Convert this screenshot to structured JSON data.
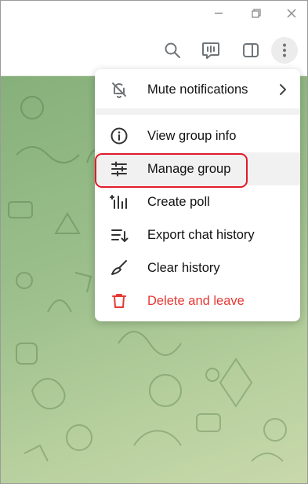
{
  "colors": {
    "accent_highlight": "#e21b2a",
    "danger": "#e53935",
    "chat_background": "#9dc08c",
    "icon_gray": "#707579"
  },
  "window": {
    "controls": [
      "minimize-icon",
      "restore-icon",
      "close-icon"
    ]
  },
  "header": {
    "icons": [
      "search-icon",
      "live-stream-icon",
      "sidebar-toggle-icon",
      "more-vertical-icon"
    ]
  },
  "menu": {
    "items": [
      {
        "label": "Mute notifications",
        "icon": "bell-off-icon",
        "has_submenu": true
      },
      {
        "label": "View group info",
        "icon": "info-icon"
      },
      {
        "label": "Manage group",
        "icon": "sliders-icon"
      },
      {
        "label": "Create poll",
        "icon": "poll-icon"
      },
      {
        "label": "Export chat history",
        "icon": "export-icon"
      },
      {
        "label": "Clear history",
        "icon": "broom-icon"
      },
      {
        "label": "Delete and leave",
        "icon": "trash-icon",
        "danger": true
      }
    ]
  }
}
